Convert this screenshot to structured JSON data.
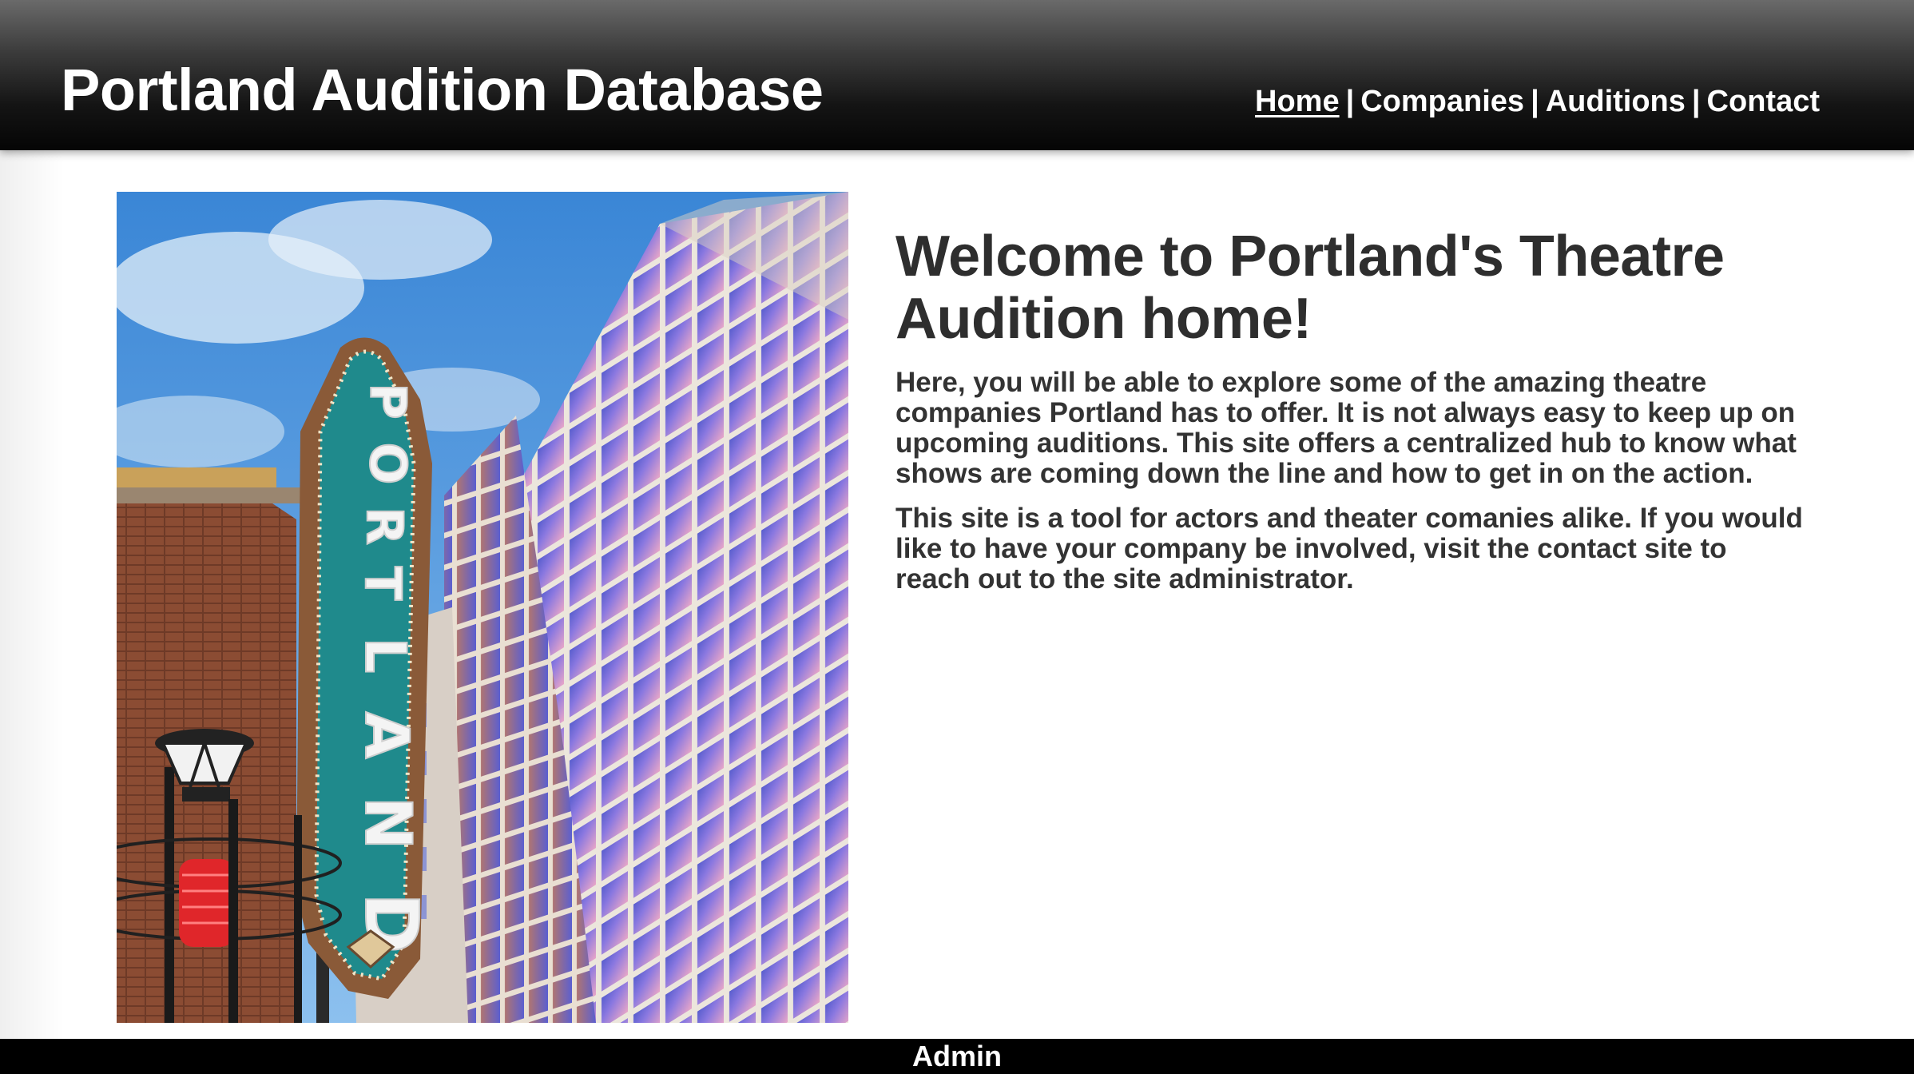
{
  "header": {
    "title": "Portland Audition Database",
    "nav": [
      {
        "label": "Home"
      },
      {
        "label": "Companies"
      },
      {
        "label": "Auditions"
      },
      {
        "label": "Contact"
      }
    ],
    "separator": "|"
  },
  "hero": {
    "sign_text": "PORTLAND",
    "sign_letters": [
      "P",
      "O",
      "R",
      "T",
      "L",
      "A",
      "N",
      "D"
    ]
  },
  "main": {
    "heading": "Welcome to Portland's Theatre Audition home!",
    "paragraphs": [
      "Here, you will be able to explore some of the amazing theatre companies Portland has to offer. It is not always easy to keep up on upcoming auditions. This site offers a centralized hub to know what shows are coming down the line and how to get in on the action.",
      "This site is a tool for actors and theater comanies alike. If you would like to have your company be involved, visit the contact site to reach out to the site administrator."
    ]
  },
  "footer": {
    "admin_label": "Admin"
  },
  "colors": {
    "header_bg": "#000000",
    "sign_teal": "#1f8a8c",
    "sky": "#4a8fd8",
    "brick": "#8a4a32",
    "text": "#2e2e2e"
  }
}
